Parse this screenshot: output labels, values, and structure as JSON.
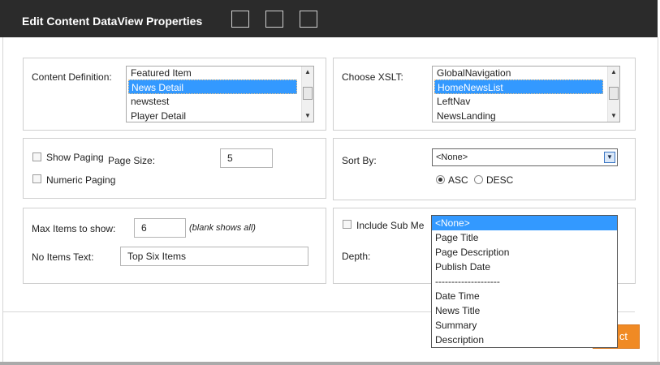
{
  "dialog": {
    "title": "Edit Content DataView Properties"
  },
  "content_definition": {
    "label": "Content Definition:",
    "items": [
      "Featured Item",
      "News Detail",
      "newstest",
      "Player Detail"
    ],
    "selected": "News Detail"
  },
  "xslt": {
    "label": "Choose XSLT:",
    "items": [
      "GlobalNavigation",
      "HomeNewsList",
      "LeftNav",
      "NewsLanding"
    ],
    "selected": "HomeNewsList"
  },
  "paging": {
    "show_paging_label": "Show Paging",
    "numeric_paging_label": "Numeric Paging",
    "page_size_label": "Page Size:",
    "page_size_value": "5"
  },
  "sort": {
    "label": "Sort By:",
    "selected": "<None>",
    "asc_label": "ASC",
    "desc_label": "DESC"
  },
  "items": {
    "max_label": "Max Items to show:",
    "max_value": "6",
    "max_hint": "(blank shows all)",
    "no_items_label": "No Items Text:",
    "no_items_value": "Top Six Items"
  },
  "submenus": {
    "include_label": "Include Sub Me",
    "depth_label": "Depth:"
  },
  "dropdown_options": [
    "<None>",
    "Page Title",
    "Page Description",
    "Publish Date",
    "--------------------",
    "Date Time",
    "News Title",
    "Summary",
    "Description"
  ],
  "footer": {
    "partial_button_label": "ct"
  }
}
